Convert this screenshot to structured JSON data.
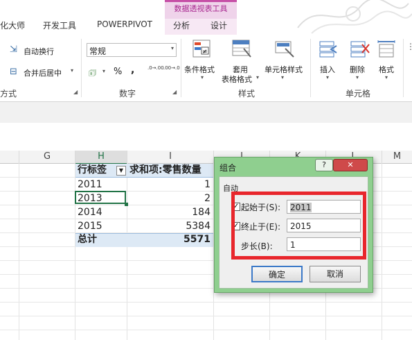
{
  "ribbon": {
    "contextual_title": "数据透视表工具",
    "tabs": [
      "化大师",
      "开发工具",
      "POWERPIVOT",
      "分析",
      "设计"
    ],
    "alignment": {
      "wrap_text": "自动换行",
      "merge_center": "合并后居中",
      "group_label": "方式"
    },
    "number": {
      "format_value": "常规",
      "percent": "%",
      "comma": ",",
      "inc_decimal": ".0→.00",
      "dec_decimal": ".00→.0",
      "group_label": "数字"
    },
    "styles": {
      "conditional": "条件格式",
      "table_format_1": "套用",
      "table_format_2": "表格格式",
      "cell_styles": "单元格样式",
      "group_label": "样式"
    },
    "cells": {
      "insert": "插入",
      "delete": "删除",
      "format": "格式",
      "group_label": "单元格"
    }
  },
  "sheet": {
    "columns": [
      "G",
      "H",
      "I",
      "J",
      "K",
      "L",
      "M"
    ],
    "pivot": {
      "header_row_label": "行标签",
      "header_value_label": "求和项:零售数量",
      "rows": [
        {
          "label": "2011",
          "value": "1"
        },
        {
          "label": "2013",
          "value": "2"
        },
        {
          "label": "2014",
          "value": "184"
        },
        {
          "label": "2015",
          "value": "5384"
        }
      ],
      "total_label": "总计",
      "total_value": "5571"
    }
  },
  "dialog": {
    "title": "组合",
    "help": "?",
    "close": "✕",
    "section_label": "自动",
    "start_label": "起始于(S):",
    "start_value": "2011",
    "end_label": "终止于(E):",
    "end_value": "2015",
    "step_label": "步长(B):",
    "step_value": "1",
    "ok": "确定",
    "cancel": "取消"
  }
}
